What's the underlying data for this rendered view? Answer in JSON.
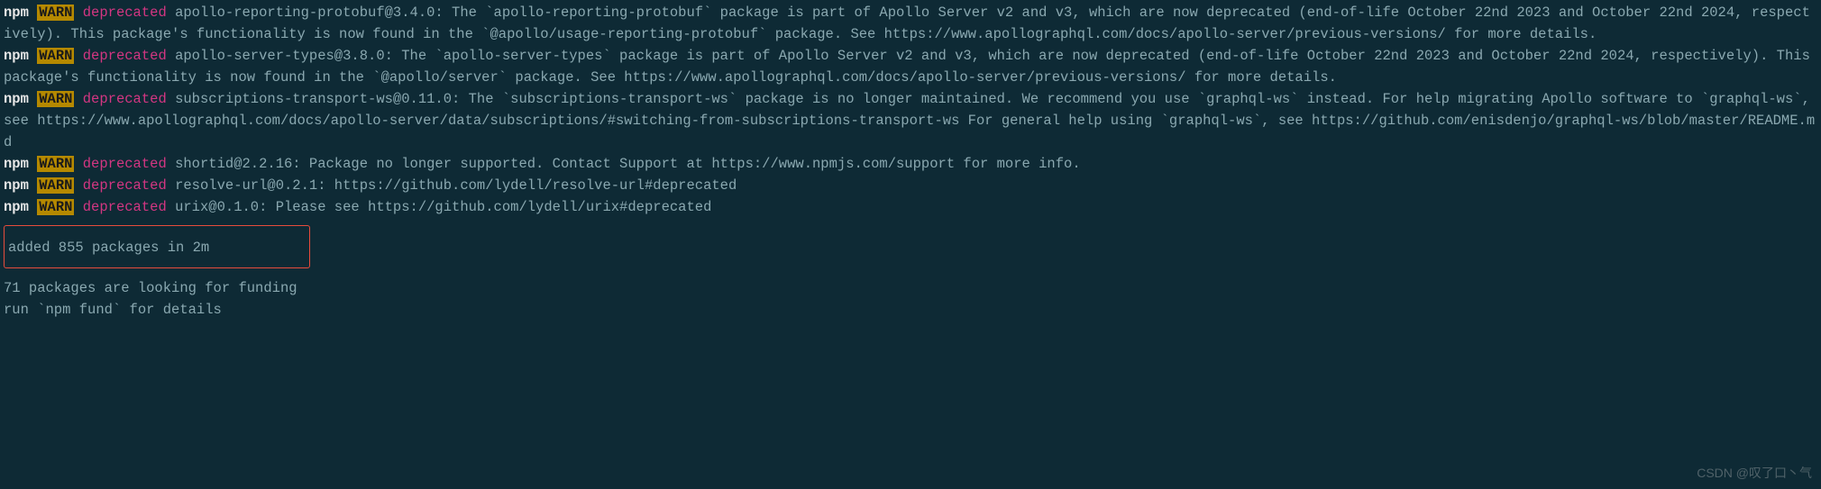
{
  "warnings": [
    {
      "prefix": "npm",
      "level": "WARN",
      "tag": "deprecated",
      "message": "apollo-reporting-protobuf@3.4.0: The `apollo-reporting-protobuf` package is part of Apollo Server v2 and v3, which are now deprecated (end-of-life October 22nd 2023 and October 22nd 2024, respectively). This package's functionality is now found in the `@apollo/usage-reporting-protobuf` package. See https://www.apollographql.com/docs/apollo-server/previous-versions/ for more details."
    },
    {
      "prefix": "npm",
      "level": "WARN",
      "tag": "deprecated",
      "message": "apollo-server-types@3.8.0: The `apollo-server-types` package is part of Apollo Server v2 and v3, which are now deprecated (end-of-life October 22nd 2023 and October 22nd 2024, respectively). This package's functionality is now found in the `@apollo/server` package. See https://www.apollographql.com/docs/apollo-server/previous-versions/ for more details."
    },
    {
      "prefix": "npm",
      "level": "WARN",
      "tag": "deprecated",
      "message": "subscriptions-transport-ws@0.11.0: The `subscriptions-transport-ws` package is no longer maintained. We recommend you use `graphql-ws` instead. For help migrating Apollo software to `graphql-ws`, see https://www.apollographql.com/docs/apollo-server/data/subscriptions/#switching-from-subscriptions-transport-ws    For general help using `graphql-ws`, see https://github.com/enisdenjo/graphql-ws/blob/master/README.md"
    },
    {
      "prefix": "npm",
      "level": "WARN",
      "tag": "deprecated",
      "message": "shortid@2.2.16: Package no longer supported. Contact Support at https://www.npmjs.com/support for more info."
    },
    {
      "prefix": "npm",
      "level": "WARN",
      "tag": "deprecated",
      "message": "resolve-url@0.2.1: https://github.com/lydell/resolve-url#deprecated"
    },
    {
      "prefix": "npm",
      "level": "WARN",
      "tag": "deprecated",
      "message": "urix@0.1.0: Please see https://github.com/lydell/urix#deprecated"
    }
  ],
  "summary": {
    "added": "added 855 packages in 2m",
    "funding_count": "71 packages are looking for funding",
    "funding_hint": "  run `npm fund` for details"
  },
  "watermark": "CSDN @叹了口丶气"
}
